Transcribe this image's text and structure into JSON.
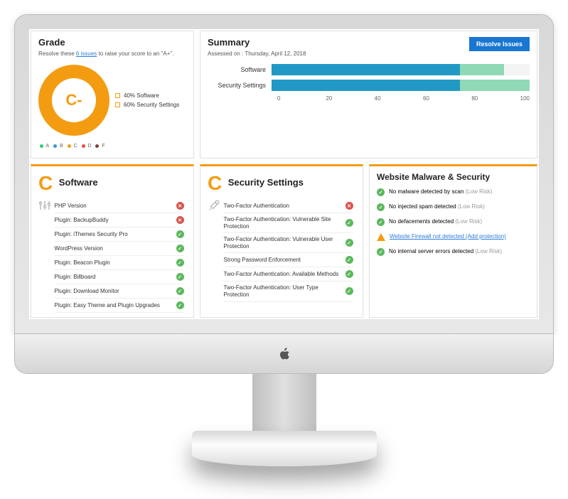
{
  "grade": {
    "title": "Grade",
    "subtitle_prefix": "Resolve these ",
    "issues_link": "6 issues",
    "subtitle_suffix": " to raise your score to an \"A+\".",
    "letter": "C-",
    "legend": [
      {
        "label": "40% Software"
      },
      {
        "label": "60% Security Settings"
      }
    ],
    "scale": [
      {
        "label": "A",
        "color": "#2ecc71"
      },
      {
        "label": "B",
        "color": "#3498db"
      },
      {
        "label": "C",
        "color": "#f39c12"
      },
      {
        "label": "D",
        "color": "#e74c3c"
      },
      {
        "label": "F",
        "color": "#7f3f3f"
      }
    ]
  },
  "summary": {
    "title": "Summary",
    "assessed": "Assessed on : Thursday, April 12, 2018",
    "resolve_button": "Resolve Issues"
  },
  "chart_data": {
    "type": "bar",
    "orientation": "horizontal",
    "xlabel": "",
    "ylabel": "",
    "xlim": [
      0,
      100
    ],
    "ticks": [
      "0",
      "20",
      "40",
      "60",
      "80",
      "100"
    ],
    "series_colors": {
      "primary": "#2199c4",
      "secondary": "#8fd9b6"
    },
    "categories": [
      "Software",
      "Security Settings"
    ],
    "series": [
      {
        "name": "primary",
        "values": [
          73,
          73
        ]
      },
      {
        "name": "secondary_end",
        "values": [
          90,
          100
        ]
      }
    ]
  },
  "software": {
    "grade": "C",
    "title": "Software",
    "items": [
      {
        "label": "PHP Version",
        "status": "fail"
      },
      {
        "label": "Plugin: BackupBuddy",
        "status": "fail"
      },
      {
        "label": "Plugin: iThemes Security Pro",
        "status": "ok"
      },
      {
        "label": "WordPress Version",
        "status": "ok"
      },
      {
        "label": "Plugin: Beacon Plugin",
        "status": "ok"
      },
      {
        "label": "Plugin: Billboard",
        "status": "ok"
      },
      {
        "label": "Plugin: Download Monitor",
        "status": "ok"
      },
      {
        "label": "Plugin: Easy Theme and Plugin Upgrades",
        "status": "ok"
      }
    ]
  },
  "security": {
    "grade": "C",
    "title": "Security Settings",
    "items": [
      {
        "label": "Two-Factor Authentication",
        "status": "fail"
      },
      {
        "label": "Two-Factor Authentication: Vulnerable Site Protection",
        "status": "ok"
      },
      {
        "label": "Two-Factor Authentication: Vulnerable User Protection",
        "status": "ok"
      },
      {
        "label": "Strong Password Enforcement",
        "status": "ok"
      },
      {
        "label": "Two-Factor Authentication: Available Methods",
        "status": "ok"
      },
      {
        "label": "Two-Factor Authentication: User Type Protection",
        "status": "ok"
      }
    ]
  },
  "malware": {
    "title": "Website Malware & Security",
    "items": [
      {
        "status": "ok",
        "text": "No malware detected by scan",
        "suffix": "(Low Risk)"
      },
      {
        "status": "ok",
        "text": "No injected spam detected",
        "suffix": "(Low Risk)"
      },
      {
        "status": "ok",
        "text": "No defacements detected",
        "suffix": "(Low Risk)"
      },
      {
        "status": "warn",
        "text": "Website Firewall not detected",
        "suffix": "(Add protection)"
      },
      {
        "status": "ok",
        "text": "No internal server errors detected",
        "suffix": "(Low Risk)"
      }
    ]
  }
}
